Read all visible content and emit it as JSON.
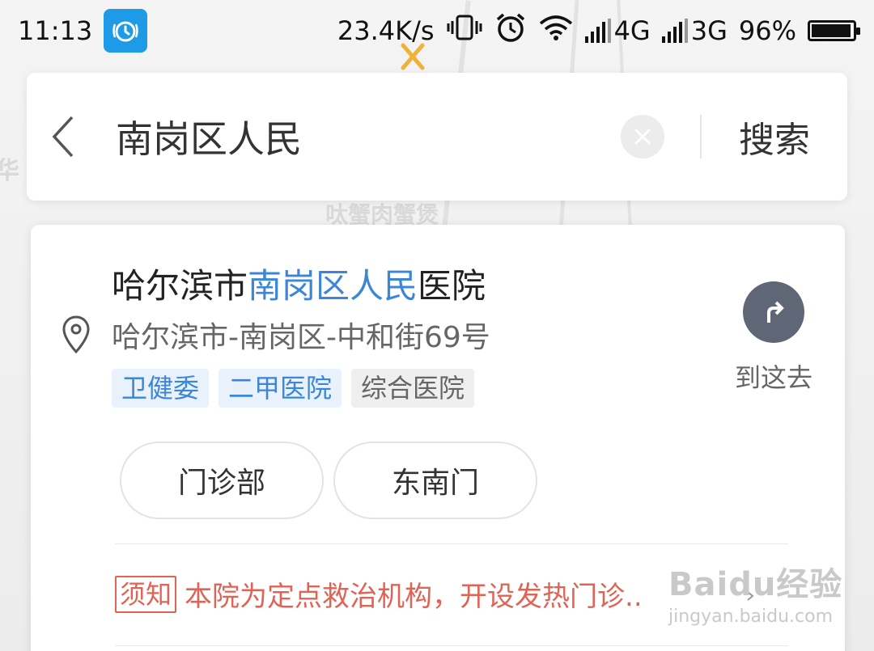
{
  "status_bar": {
    "time": "11:13",
    "net_speed": "23.4K/s",
    "sim1_type": "4G",
    "sim2_type": "3G",
    "battery": "96%",
    "battery_level": 0.96,
    "icons": [
      "alarm-app-icon",
      "vibrate-icon",
      "alarm-clock-icon",
      "wifi-icon",
      "signal-icon",
      "battery-icon"
    ]
  },
  "map": {
    "labels": [
      "华",
      "呔蟹肉蟹煲"
    ],
    "poi_icon": "restaurant-icon"
  },
  "search": {
    "query": "南岗区人民",
    "submit_label": "搜索"
  },
  "result": {
    "title_prefix": "哈尔滨市",
    "title_highlight": "南岗区人民",
    "title_suffix": "医院",
    "address": "哈尔滨市-南岗区-中和街69号",
    "tags": [
      "卫健委",
      "二甲医院",
      "综合医院"
    ],
    "goto_label": "到这去",
    "sub_pois": [
      "门诊部",
      "东南门"
    ],
    "notice_badge": "须知",
    "notice_text": "本院为定点救治机构，开设发热门诊.."
  },
  "colors": {
    "highlight": "#3b86d8",
    "notice": "#e06455",
    "goto_button": "#5f6777"
  },
  "watermark": {
    "main": "Baidu经验",
    "sub": "jingyan.baidu.com"
  }
}
